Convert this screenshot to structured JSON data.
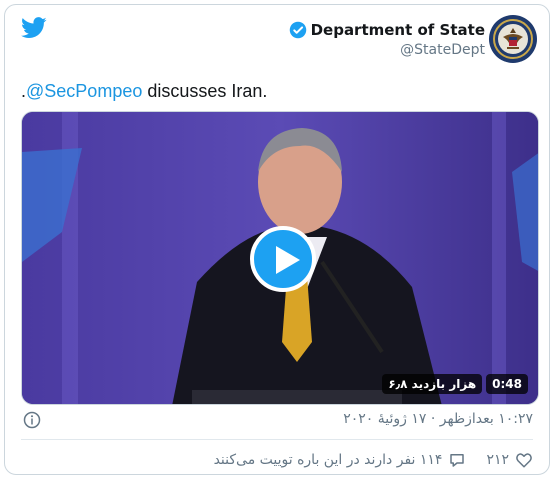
{
  "tweet": {
    "author_name": "Department of State",
    "author_handle": "@StateDept",
    "text_mention": "@SecPompeo",
    "text_body": " discusses Iran.",
    "text_prefix": ".",
    "timestamp": "۱۰:۲۷ بعدازظهر · ۱۷ ژوئیهٔ ۲۰۲۰",
    "likes": "۲۱۲",
    "replies_text": "۱۱۴ نفر دارند در این باره توییت می‌کنند"
  },
  "video": {
    "duration": "0:48",
    "views": "۶٫۸ هزار بازدید"
  },
  "colors": {
    "twitter_blue": "#1da1f2",
    "link": "#1b95e0",
    "muted": "#657786",
    "like_red": "#e0245e"
  }
}
